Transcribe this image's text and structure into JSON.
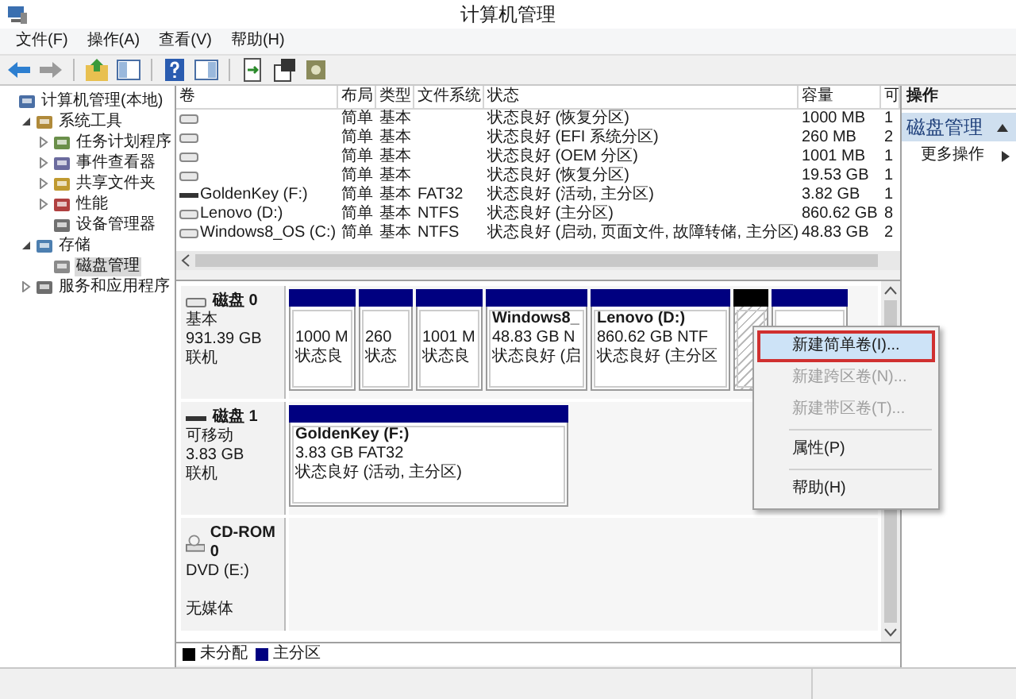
{
  "window": {
    "title": "计算机管理"
  },
  "menu": [
    "文件(F)",
    "操作(A)",
    "查看(V)",
    "帮助(H)"
  ],
  "tree": [
    {
      "label": "计算机管理(本地)",
      "selected": false,
      "children": [
        {
          "label": "系统工具",
          "expanded": true,
          "selected": false,
          "children": [
            {
              "label": "任务计划程序",
              "expanded": false,
              "selected": false
            },
            {
              "label": "事件查看器",
              "expanded": false,
              "selected": false
            },
            {
              "label": "共享文件夹",
              "expanded": false,
              "selected": false
            },
            {
              "label": "性能",
              "expanded": false,
              "selected": false
            },
            {
              "label": "设备管理器",
              "selected": false
            }
          ]
        },
        {
          "label": "存储",
          "expanded": true,
          "selected": false,
          "children": [
            {
              "label": "磁盘管理",
              "selected": true
            }
          ]
        },
        {
          "label": "服务和应用程序",
          "expanded": false,
          "selected": false
        }
      ]
    }
  ],
  "volumes": {
    "columns": [
      "卷",
      "布局",
      "类型",
      "文件系统",
      "状态",
      "容量",
      "可"
    ],
    "rows": [
      {
        "kind": "fixed",
        "layout": "简单",
        "type": "基本",
        "status": "状态良好 (恢复分区)",
        "capacity": "1000 MB",
        "column_7": "1"
      },
      {
        "kind": "fixed",
        "layout": "简单",
        "type": "基本",
        "status": "状态良好 (EFI 系统分区)",
        "capacity": "260 MB",
        "column_7": "2"
      },
      {
        "kind": "fixed",
        "layout": "简单",
        "type": "基本",
        "status": "状态良好 (OEM 分区)",
        "capacity": "1001 MB",
        "column_7": "1"
      },
      {
        "kind": "fixed",
        "layout": "简单",
        "type": "基本",
        "status": "状态良好 (恢复分区)",
        "capacity": "19.53 GB",
        "column_7": "1"
      },
      {
        "kind": "removable",
        "volume": "GoldenKey (F:)",
        "layout": "简单",
        "type": "基本",
        "filesystem": "FAT32",
        "status": "状态良好 (活动, 主分区)",
        "capacity": "3.82 GB",
        "column_7": "1"
      },
      {
        "kind": "fixed",
        "volume": "Lenovo (D:)",
        "layout": "简单",
        "type": "基本",
        "filesystem": "NTFS",
        "status": "状态良好 (主分区)",
        "capacity": "860.62 GB",
        "column_7": "8"
      },
      {
        "kind": "fixed",
        "volume": "Windows8_OS (C:)",
        "layout": "简单",
        "type": "基本",
        "filesystem": "NTFS",
        "status": "状态良好 (启动, 页面文件, 故障转储, 主分区)",
        "capacity": "48.83 GB",
        "column_7": "2"
      }
    ]
  },
  "disks": [
    {
      "kind": "basic",
      "name": "磁盘 0",
      "lines": [
        "基本",
        "931.39 GB",
        "联机"
      ],
      "partitions": [
        {
          "kind": "primary",
          "color": "#000080",
          "lines": [
            "1000 M",
            "状态良"
          ]
        },
        {
          "kind": "primary",
          "color": "#000080",
          "lines": [
            "260",
            "状态"
          ]
        },
        {
          "kind": "primary",
          "color": "#000080",
          "lines": [
            "1001 M",
            "状态良"
          ]
        },
        {
          "kind": "primary",
          "color": "#000080",
          "name": "Windows8_",
          "lines": [
            "48.83 GB N",
            "状态良好 (启"
          ]
        },
        {
          "kind": "primary",
          "color": "#000080",
          "name": "Lenovo  (D:)",
          "lines": [
            "860.62 GB NTF",
            "状态良好 (主分区"
          ]
        },
        {
          "kind": "unallocated",
          "color": "#000000"
        },
        {
          "kind": "primary",
          "color": "#000080"
        }
      ]
    },
    {
      "kind": "removable",
      "name": "磁盘 1",
      "lines": [
        "可移动",
        "3.83 GB",
        "联机"
      ],
      "partitions": [
        {
          "kind": "primary",
          "color": "#000080",
          "name": "GoldenKey  (F:)",
          "lines": [
            "3.83 GB FAT32",
            "状态良好 (活动, 主分区)"
          ]
        }
      ]
    },
    {
      "kind": "cdrom",
      "name": "CD-ROM 0",
      "lines": [
        "DVD (E:)"
      ],
      "media": "无媒体"
    }
  ],
  "legend": [
    {
      "label": "未分配",
      "color": "#000000"
    },
    {
      "label": "主分区",
      "color": "#000080"
    }
  ],
  "actions": {
    "header": "操作",
    "items": [
      {
        "kind": "section",
        "label": "磁盘管理"
      },
      {
        "kind": "submenu",
        "label": "更多操作"
      }
    ]
  },
  "context_menu": [
    {
      "kind": "item",
      "label": "新建简单卷(I)...",
      "disabled": false,
      "selected": true
    },
    {
      "kind": "item",
      "label": "新建跨区卷(N)...",
      "disabled": true,
      "selected": false
    },
    {
      "kind": "item",
      "label": "新建带区卷(T)...",
      "disabled": true,
      "selected": false
    },
    {
      "kind": "separator"
    },
    {
      "kind": "item",
      "label": "属性(P)",
      "disabled": false,
      "selected": false
    },
    {
      "kind": "separator"
    },
    {
      "kind": "item",
      "label": "帮助(H)",
      "disabled": false,
      "selected": false
    }
  ]
}
